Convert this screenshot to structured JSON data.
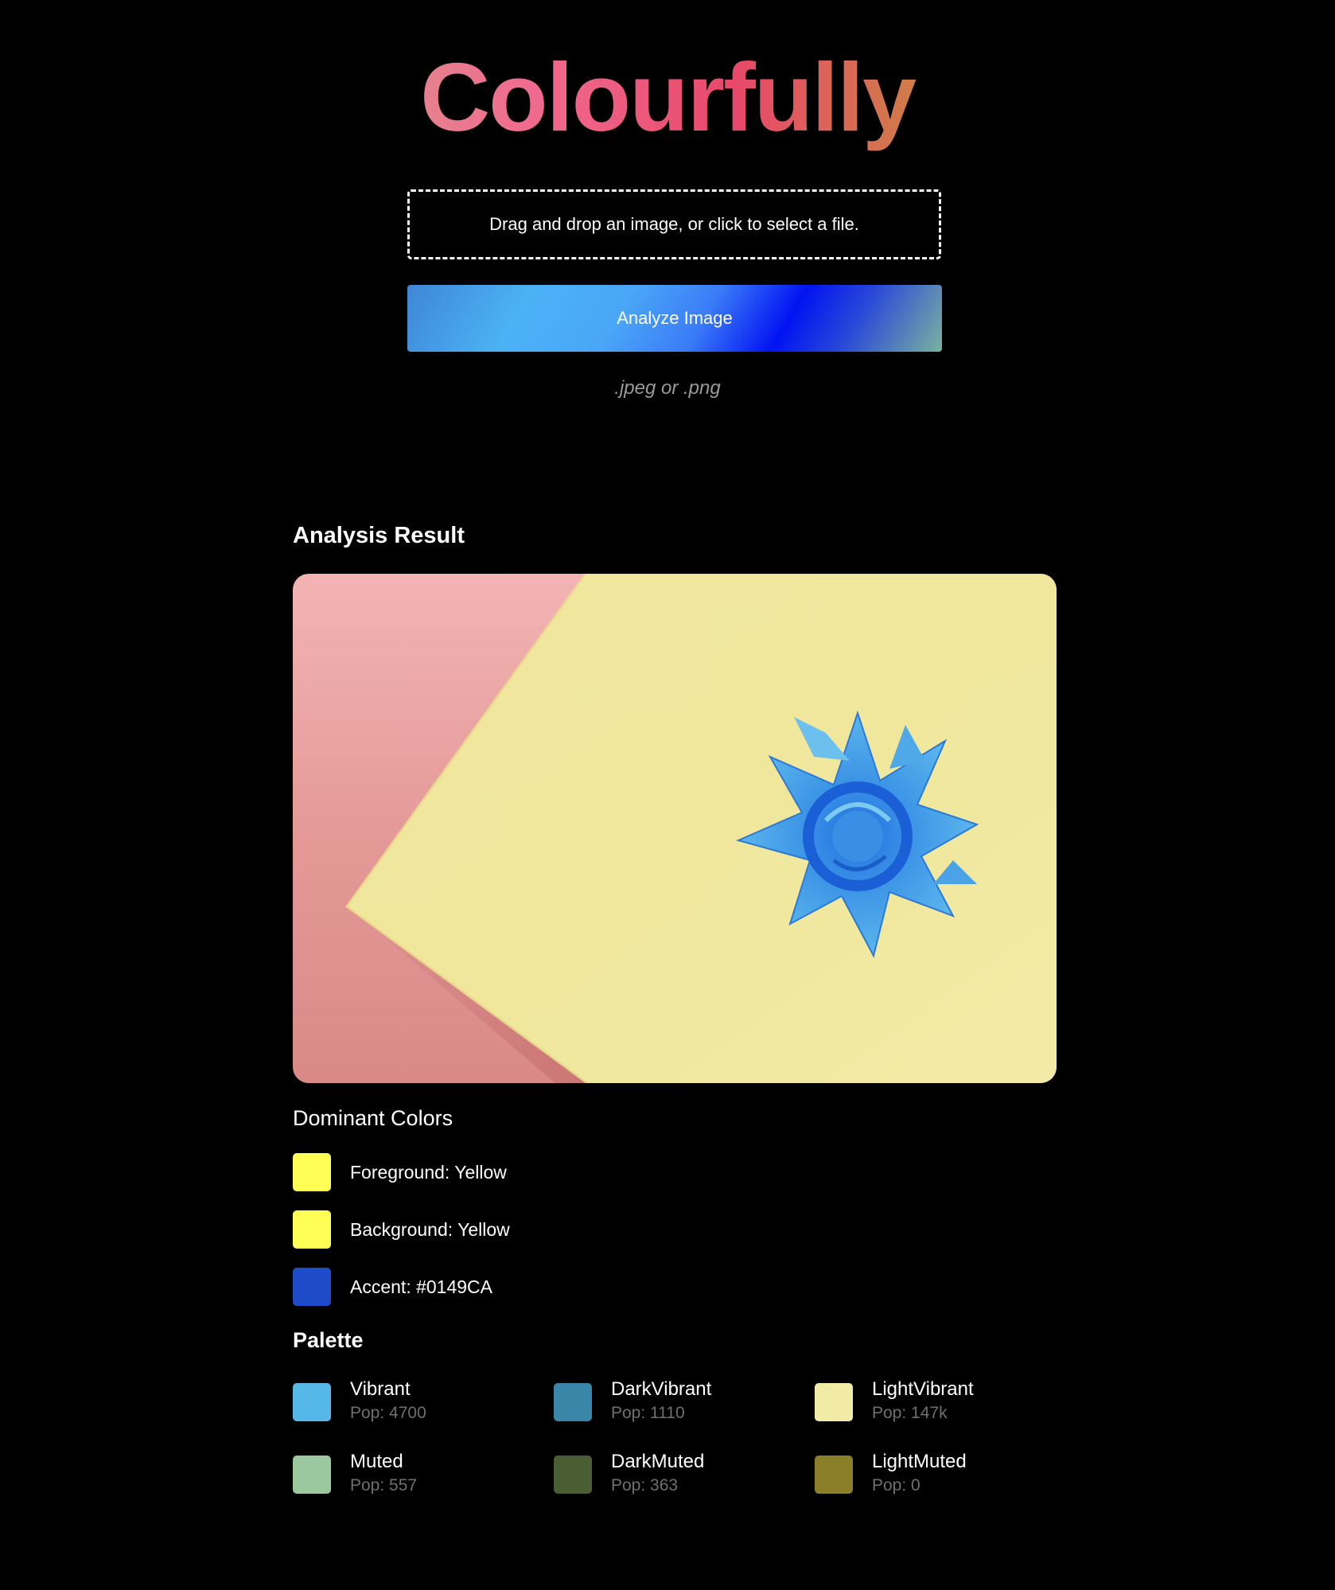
{
  "app": {
    "title": "Colourfully"
  },
  "upload": {
    "dropzone_text": "Drag and drop an image, or click to select a file.",
    "analyze_label": "Analyze Image",
    "formats_hint": ".jpeg or .png"
  },
  "result": {
    "heading": "Analysis Result",
    "image_icon": "gift-bow-photo"
  },
  "dominant": {
    "heading": "Dominant Colors",
    "items": [
      {
        "label": "Foreground: Yellow",
        "color": "#FFFF55"
      },
      {
        "label": "Background: Yellow",
        "color": "#FFFF55"
      },
      {
        "label": "Accent: #0149CA",
        "color": "#1E4BC8"
      }
    ]
  },
  "palette": {
    "heading": "Palette",
    "items": [
      {
        "name": "Vibrant",
        "pop": "Pop: 4700",
        "color": "#56B8E6"
      },
      {
        "name": "DarkVibrant",
        "pop": "Pop: 1110",
        "color": "#3A86A8"
      },
      {
        "name": "LightVibrant",
        "pop": "Pop: 147k",
        "color": "#F2EBA6"
      },
      {
        "name": "Muted",
        "pop": "Pop: 557",
        "color": "#9CC8A0"
      },
      {
        "name": "DarkMuted",
        "pop": "Pop: 363",
        "color": "#4A5E33"
      },
      {
        "name": "LightMuted",
        "pop": "Pop: 0",
        "color": "#8A7E28"
      }
    ]
  }
}
